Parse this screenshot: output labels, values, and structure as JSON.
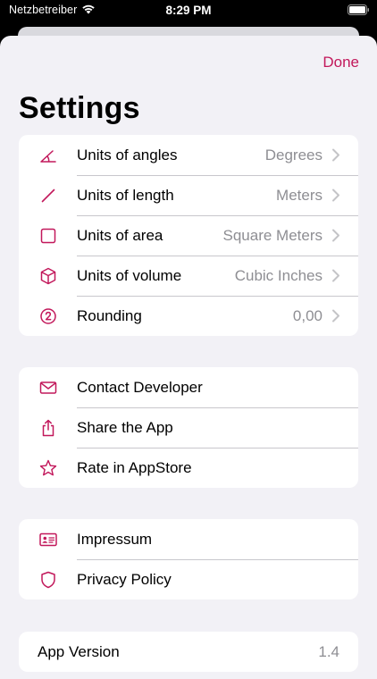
{
  "status_bar": {
    "carrier": "Netzbetreiber",
    "time": "8:29 PM"
  },
  "header": {
    "done_label": "Done",
    "title": "Settings"
  },
  "colors": {
    "accent": "#c2185b",
    "background": "#f2f1f6",
    "secondary_text": "#8e8e93"
  },
  "units": [
    {
      "icon": "angle-icon",
      "label": "Units of angles",
      "value": "Degrees"
    },
    {
      "icon": "length-icon",
      "label": "Units of length",
      "value": "Meters"
    },
    {
      "icon": "square-icon",
      "label": "Units of area",
      "value": "Square Meters"
    },
    {
      "icon": "cube-icon",
      "label": "Units of volume",
      "value": "Cubic Inches"
    },
    {
      "icon": "number-two-circle-icon",
      "label": "Rounding",
      "value": "0,00"
    }
  ],
  "actions": [
    {
      "icon": "envelope-icon",
      "label": "Contact Developer"
    },
    {
      "icon": "share-icon",
      "label": "Share the App"
    },
    {
      "icon": "star-icon",
      "label": "Rate in AppStore"
    }
  ],
  "legal": [
    {
      "icon": "id-card-icon",
      "label": "Impressum"
    },
    {
      "icon": "shield-icon",
      "label": "Privacy Policy"
    }
  ],
  "version": {
    "label": "App Version",
    "value": "1.4"
  }
}
